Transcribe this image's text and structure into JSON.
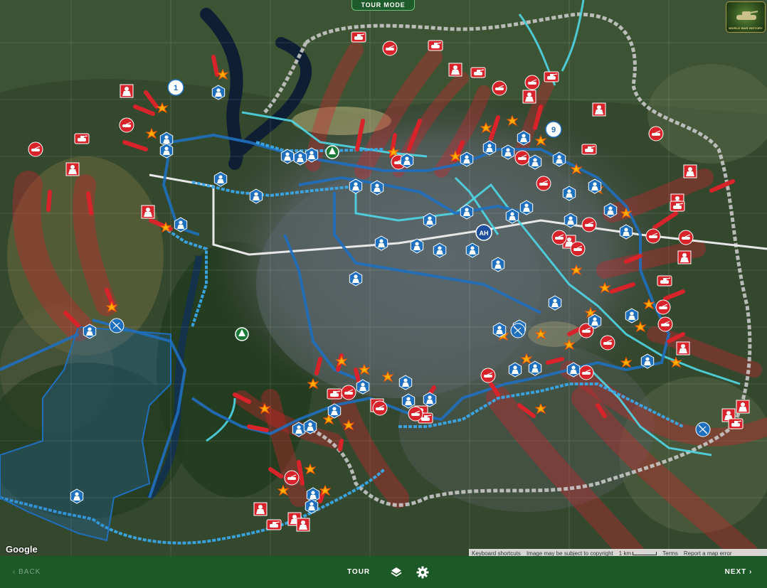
{
  "header": {
    "mode_label": "TOUR MODE"
  },
  "logo": {
    "text": "WORLD WAR HISTORY"
  },
  "map": {
    "step_markers": [
      {
        "label": "1"
      },
      {
        "label": "9"
      }
    ],
    "hq_marker": {
      "label": "AH"
    },
    "provider_logo": "Google",
    "attribution": {
      "shortcuts": "Keyboard shortcuts",
      "copyright": "Image may be subject to copyright",
      "scale": "1 km",
      "terms": "Terms",
      "report": "Report a map error"
    }
  },
  "footer": {
    "back_label": "BACK",
    "tour_label": "TOUR",
    "next_label": "NEXT",
    "layers_icon": "layers-icon",
    "settings_icon": "gear-icon"
  },
  "colors": {
    "soviet_red": "#d9232a",
    "german_blue": "#1f6fbf",
    "river_cyan": "#4fd6e6",
    "brand_green": "#1b5a26"
  }
}
